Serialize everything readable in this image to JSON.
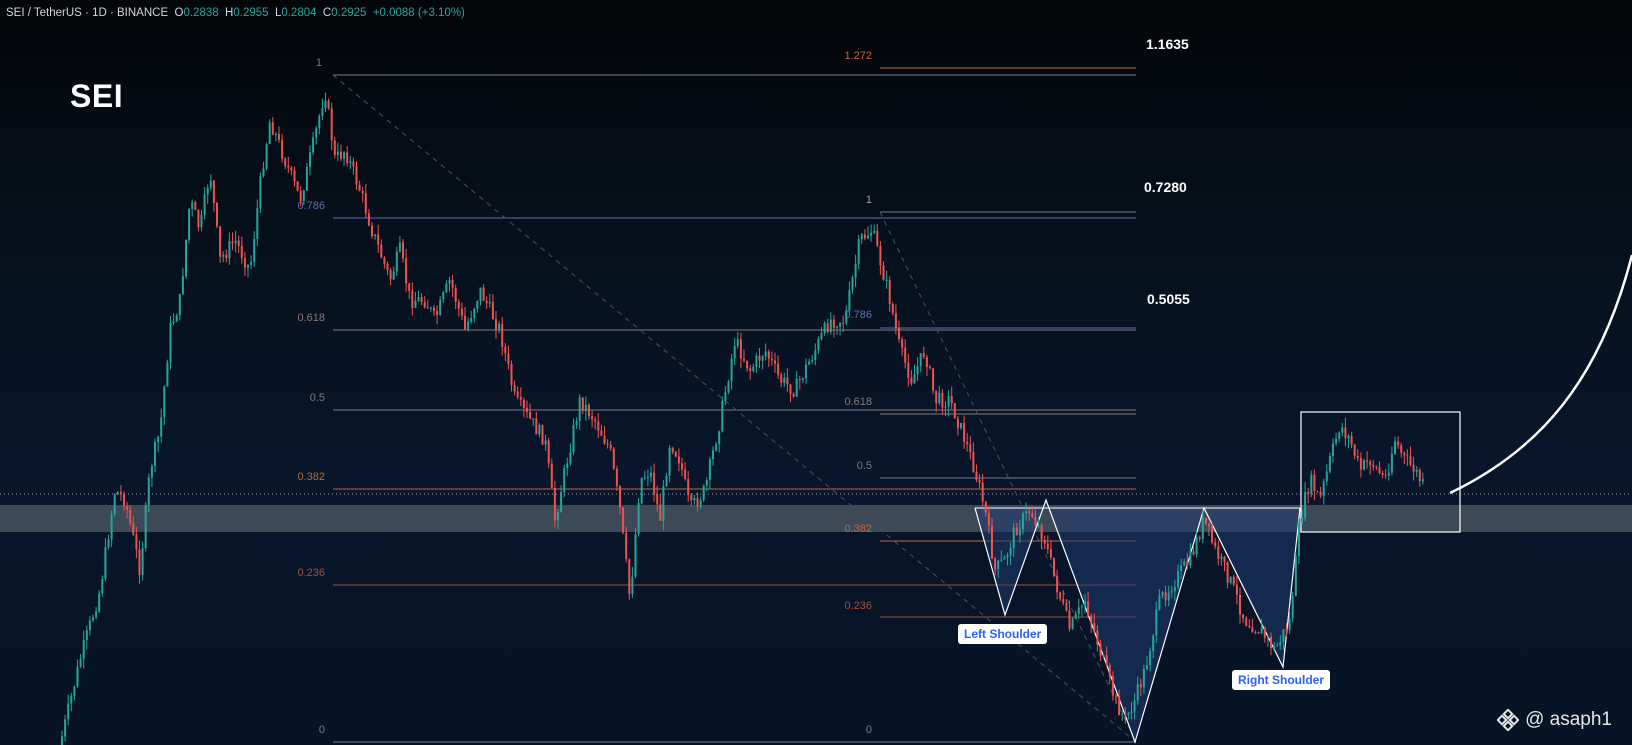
{
  "header": {
    "symbol": "SEI / TetherUS · 1D · BINANCE",
    "open_label": "O",
    "open": "0.2838",
    "high_label": "H",
    "high": "0.2955",
    "low_label": "L",
    "low": "0.2804",
    "close_label": "C",
    "close": "0.2925",
    "change": "+0.0088 (+3.10%)"
  },
  "title": "SEI",
  "targets": [
    "1.1635",
    "0.7280",
    "0.5055"
  ],
  "annotations": {
    "left_shoulder": "Left Shoulder",
    "right_shoulder": "Right Shoulder"
  },
  "watermark": {
    "handle": "@ asaph1",
    "icon": "binance-logo-icon"
  },
  "colors": {
    "up": "#26a69a",
    "down": "#ef5350",
    "support_zone": "#6b7480",
    "pattern_fill": "#1e3a6e",
    "fib_gray": "#787b86",
    "fib_orange": "#f57c3b",
    "fib_blue": "#5b6fb0"
  },
  "chart_data": {
    "type": "candlestick",
    "symbol": "SEI/USDT",
    "timeframe": "1D",
    "fib_retracement_1": {
      "levels": [
        "1",
        "0.786",
        "0.618",
        "0.5",
        "0.382",
        "0.236",
        "0"
      ]
    },
    "fib_retracement_2": {
      "levels": [
        "1.272",
        "1",
        "0.786",
        "0.618",
        "0.5",
        "0.382",
        "0.236",
        "0"
      ]
    },
    "pattern": "inverse head and shoulders",
    "support_zone": true
  }
}
